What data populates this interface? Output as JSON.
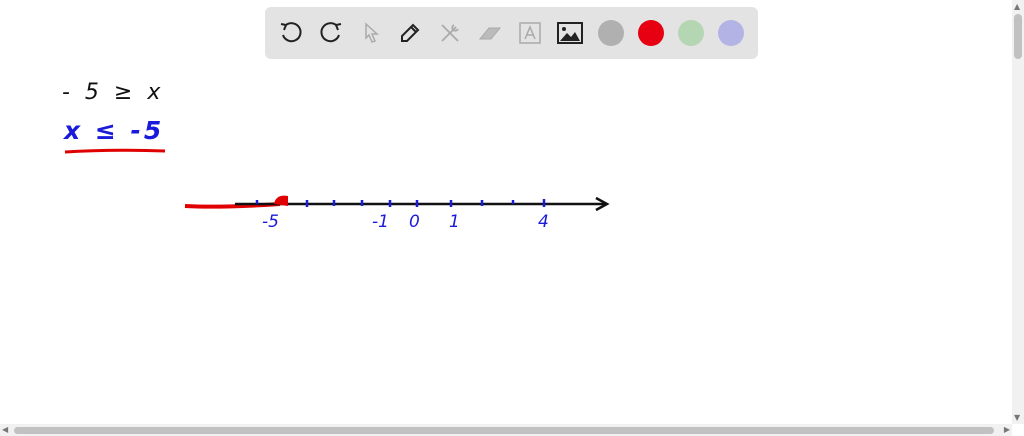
{
  "toolbar": {
    "tools": [
      "undo-icon",
      "redo-icon",
      "select-icon",
      "pen-icon",
      "tools-icon",
      "eraser-icon",
      "text-icon",
      "image-icon"
    ],
    "colors": [
      "#b0b0b0",
      "#e60012",
      "#b5d6b3",
      "#b3b3e6"
    ]
  },
  "canvas": {
    "line1": "- 5 ≥ x",
    "line2": "x ≤ -5",
    "number_line": {
      "labels": [
        "-5",
        "-1",
        "0",
        "1",
        "4"
      ],
      "ink_blue": "#1a1adb",
      "ink_red": "#e00000"
    }
  }
}
